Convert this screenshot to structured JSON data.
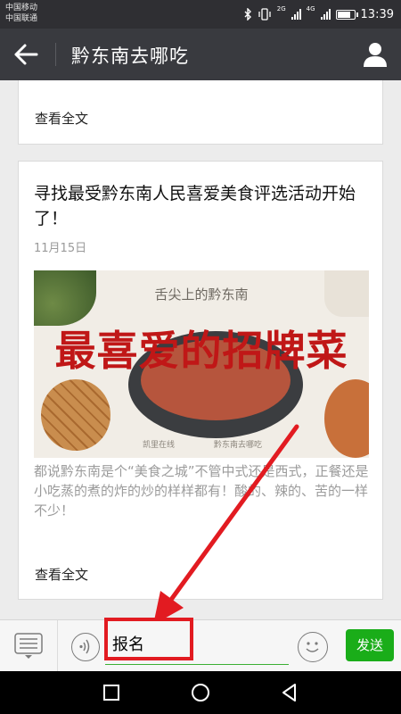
{
  "status_bar": {
    "carrier_1": "中国移动",
    "carrier_2": "中国联通",
    "time": "13:39",
    "network_1": "2G",
    "network_2": "4G",
    "icons": [
      "bluetooth-icon",
      "vibrate-icon",
      "signal-icon",
      "signal-icon",
      "battery-icon"
    ]
  },
  "header": {
    "title": "黔东南去哪吃",
    "back_icon": "back-arrow-icon",
    "profile_icon": "person-icon"
  },
  "cards": [
    {
      "read_more": "查看全文"
    },
    {
      "title": "寻找最受黔东南人民喜爱美食评选活动开始了！",
      "date": "11月15日",
      "cover": {
        "subtitle": "舌尖上的黔东南",
        "headline": "最喜爱的招牌菜",
        "footer_left": "凯里在线",
        "footer_right": "黔东南去哪吃"
      },
      "summary": "都说黔东南是个“美食之城”不管中式还是西式，正餐还是小吃蒸的煮的炸的炒的样样都有！酸的、辣的、苦的一样不少！",
      "read_more": "查看全文"
    }
  ],
  "input_bar": {
    "menu_icon": "list-menu-icon",
    "voice_icon": "voice-icon",
    "message_value": "报名",
    "emoji_icon": "emoji-icon",
    "send_label": "发送"
  },
  "annotation": {
    "color": "#e21b21"
  },
  "colors": {
    "accent": "#1aad19",
    "header_bg": "#393a3f",
    "highlight": "#e21b21"
  },
  "nav": {
    "icons": [
      "recent-apps-icon",
      "home-icon",
      "back-triangle-icon"
    ]
  }
}
